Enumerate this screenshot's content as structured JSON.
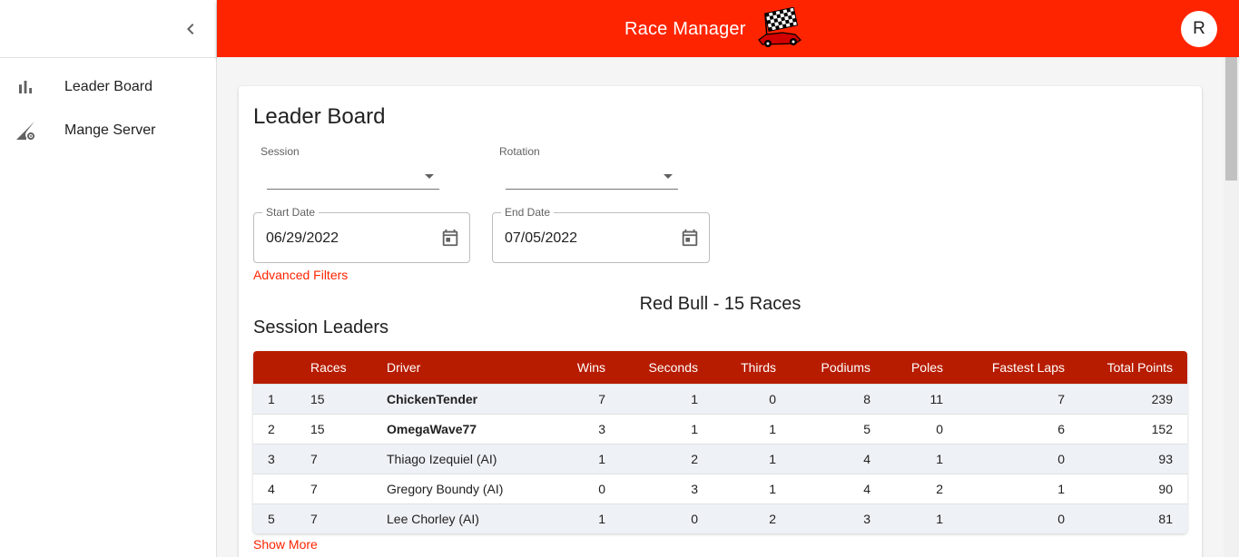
{
  "app": {
    "title": "Race Manager",
    "avatar_initial": "R"
  },
  "sidebar": {
    "items": [
      {
        "label": "Leader Board",
        "icon": "bar-chart-icon"
      },
      {
        "label": "Mange Server",
        "icon": "signal-settings-icon"
      }
    ]
  },
  "page": {
    "title": "Leader Board",
    "filters": {
      "session_label": "Session",
      "session_value": "",
      "rotation_label": "Rotation",
      "rotation_value": "",
      "start_date_label": "Start Date",
      "start_date_value": "06/29/2022",
      "end_date_label": "End Date",
      "end_date_value": "07/05/2022",
      "advanced_filters": "Advanced Filters"
    },
    "summary": "Red Bull - 15 Races",
    "section_title": "Session Leaders",
    "show_more": "Show More"
  },
  "table": {
    "columns": [
      "",
      "Races",
      "Driver",
      "Wins",
      "Seconds",
      "Thirds",
      "Podiums",
      "Poles",
      "Fastest Laps",
      "Total Points"
    ],
    "rows": [
      {
        "rank": "1",
        "races": "15",
        "driver": "ChickenTender",
        "bold": true,
        "wins": "7",
        "seconds": "1",
        "thirds": "0",
        "podiums": "8",
        "poles": "11",
        "fastest_laps": "7",
        "total_points": "239"
      },
      {
        "rank": "2",
        "races": "15",
        "driver": "OmegaWave77",
        "bold": true,
        "wins": "3",
        "seconds": "1",
        "thirds": "1",
        "podiums": "5",
        "poles": "0",
        "fastest_laps": "6",
        "total_points": "152"
      },
      {
        "rank": "3",
        "races": "7",
        "driver": "Thiago Izequiel (AI)",
        "bold": false,
        "wins": "1",
        "seconds": "2",
        "thirds": "1",
        "podiums": "4",
        "poles": "1",
        "fastest_laps": "0",
        "total_points": "93"
      },
      {
        "rank": "4",
        "races": "7",
        "driver": "Gregory Boundy (AI)",
        "bold": false,
        "wins": "0",
        "seconds": "3",
        "thirds": "1",
        "podiums": "4",
        "poles": "2",
        "fastest_laps": "1",
        "total_points": "90"
      },
      {
        "rank": "5",
        "races": "7",
        "driver": "Lee Chorley (AI)",
        "bold": false,
        "wins": "1",
        "seconds": "0",
        "thirds": "2",
        "podiums": "3",
        "poles": "1",
        "fastest_laps": "0",
        "total_points": "81"
      }
    ]
  },
  "colors": {
    "accent": "#ff2400",
    "table_header": "#b71c00",
    "row_alt": "#eef1f5"
  }
}
